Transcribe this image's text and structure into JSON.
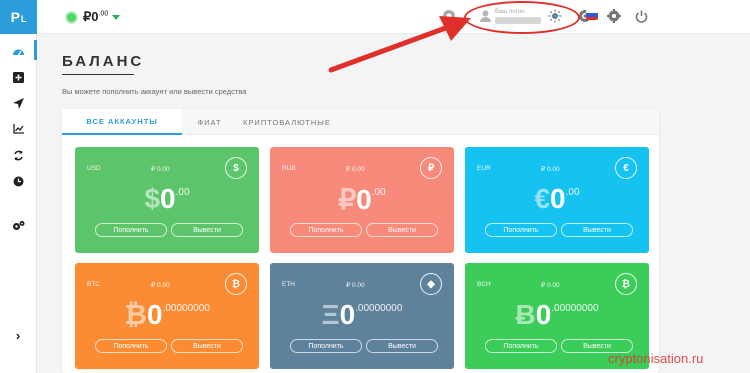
{
  "sidebar": {
    "logo": "P",
    "logo_sub": "L",
    "expand": "›"
  },
  "topbar": {
    "balance_int": "₽0",
    "balance_dec": ".00",
    "user_label": "Ваш логин"
  },
  "page": {
    "title": "БАЛАНС",
    "subtitle": "Вы можете пополнить аккаунт или вывести средства"
  },
  "tabs": [
    {
      "label": "ВСЕ АККАУНТЫ"
    },
    {
      "label": "ФИАТ"
    },
    {
      "label": "КРИПТОВАЛЮТНЫЕ"
    }
  ],
  "cards": [
    {
      "currency": "USD",
      "rub": "₽ 0.00",
      "icon": "$",
      "symbol": "$",
      "int": "0",
      "dec": ".00",
      "deposit": "Пополнить",
      "withdraw": "Вывести",
      "color": "#5cc56b"
    },
    {
      "currency": "RUB",
      "rub": "₽ 0.00",
      "icon": "₽",
      "symbol": "₽",
      "int": "0",
      "dec": ".00",
      "deposit": "Пополнить",
      "withdraw": "Вывести",
      "color": "#f78a7b"
    },
    {
      "currency": "EUR",
      "rub": "₽ 0.00",
      "icon": "€",
      "symbol": "€",
      "int": "0",
      "dec": ".00",
      "deposit": "Пополнить",
      "withdraw": "Вывести",
      "color": "#15c2f0"
    },
    {
      "currency": "BTC",
      "rub": "₽ 0.00",
      "icon": "₿",
      "symbol": "₿",
      "int": "0",
      "dec": ".00000000",
      "deposit": "Пополнить",
      "withdraw": "Вывести",
      "color": "#fb8c33"
    },
    {
      "currency": "ETH",
      "rub": "₽ 0.00",
      "icon": "◆",
      "symbol": "Ξ",
      "int": "0",
      "dec": ".00000000",
      "deposit": "Пополнить",
      "withdraw": "Вывести",
      "color": "#5e819c"
    },
    {
      "currency": "BCH",
      "rub": "₽ 0.00",
      "icon": "₿",
      "symbol": "Ƀ",
      "int": "0",
      "dec": ".00000000",
      "deposit": "Пополнить",
      "withdraw": "Вывести",
      "color": "#3ccc5a"
    }
  ],
  "watermark": "cryptonisation.ru",
  "colors": {
    "accent": "#2d9cdb",
    "highlight": "#e0302b"
  }
}
